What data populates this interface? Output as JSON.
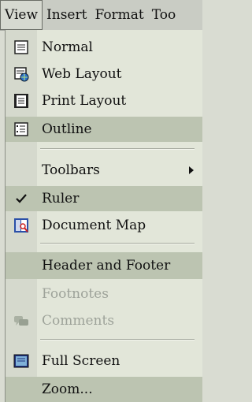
{
  "menubar": {
    "items": [
      {
        "label": "View"
      },
      {
        "label": "Insert"
      },
      {
        "label": "Format"
      },
      {
        "label": "Too"
      }
    ]
  },
  "view_menu": {
    "items": [
      {
        "label": "Normal"
      },
      {
        "label": "Web Layout"
      },
      {
        "label": "Print Layout"
      },
      {
        "label": "Outline"
      },
      {
        "label": "Toolbars"
      },
      {
        "label": "Ruler",
        "checked": true
      },
      {
        "label": "Document Map"
      },
      {
        "label": "Header and Footer"
      },
      {
        "label": "Footnotes",
        "disabled": true
      },
      {
        "label": "Comments",
        "disabled": true
      },
      {
        "label": "Full Screen"
      },
      {
        "label": "Zoom..."
      }
    ]
  }
}
